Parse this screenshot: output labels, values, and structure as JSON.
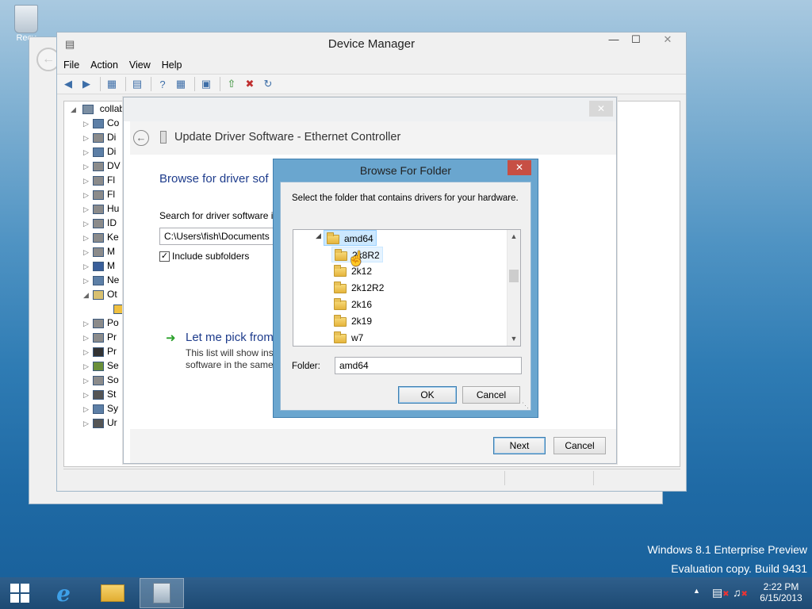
{
  "desktop": {
    "recycle_label": "Recy"
  },
  "device_manager": {
    "title": "Device Manager",
    "menu": [
      "File",
      "Action",
      "View",
      "Help"
    ],
    "root_label": "collab",
    "tree_items": [
      "Co",
      "Di",
      "Di",
      "DV",
      "Fl",
      "Fl",
      "Hu",
      "ID",
      "Ke",
      "M",
      "M",
      "Ne",
      "Ot",
      "",
      "Po",
      "Pr",
      "Pr",
      "Se",
      "So",
      "St",
      "Sy",
      "Ur"
    ]
  },
  "wizard": {
    "title": "Update Driver Software - Ethernet Controller",
    "heading": "Browse for driver sof",
    "search_label": "Search for driver software i",
    "path_value": "C:\\Users\\fish\\Documents",
    "include_subfolders_label": "Include subfolders",
    "pick_heading": "Let me pick from",
    "pick_desc_line1": "This list will show inst",
    "pick_desc_line2": "software in the same",
    "next_label": "Next",
    "cancel_label": "Cancel"
  },
  "browse_dialog": {
    "title": "Browse For Folder",
    "instruction": "Select the folder that contains drivers for your hardware.",
    "folders": [
      {
        "label": "amd64",
        "level": 0,
        "state": "selected"
      },
      {
        "label": "2k8R2",
        "level": 1,
        "state": "hover"
      },
      {
        "label": "2k12",
        "level": 1,
        "state": ""
      },
      {
        "label": "2k12R2",
        "level": 1,
        "state": ""
      },
      {
        "label": "2k16",
        "level": 1,
        "state": ""
      },
      {
        "label": "2k19",
        "level": 1,
        "state": ""
      },
      {
        "label": "w7",
        "level": 1,
        "state": ""
      }
    ],
    "folder_label": "Folder:",
    "folder_value": "amd64",
    "ok_label": "OK",
    "cancel_label": "Cancel"
  },
  "watermark": {
    "line1": "Windows 8.1 Enterprise Preview",
    "line2": "Evaluation copy. Build 9431"
  },
  "taskbar": {
    "time": "2:22 PM",
    "date": "6/15/2013"
  },
  "colors": {
    "dialog_frame": "#6aa6cf",
    "close_red": "#c74f44",
    "taskbar": "#1d4a73",
    "link_green": "#2aa02a"
  }
}
